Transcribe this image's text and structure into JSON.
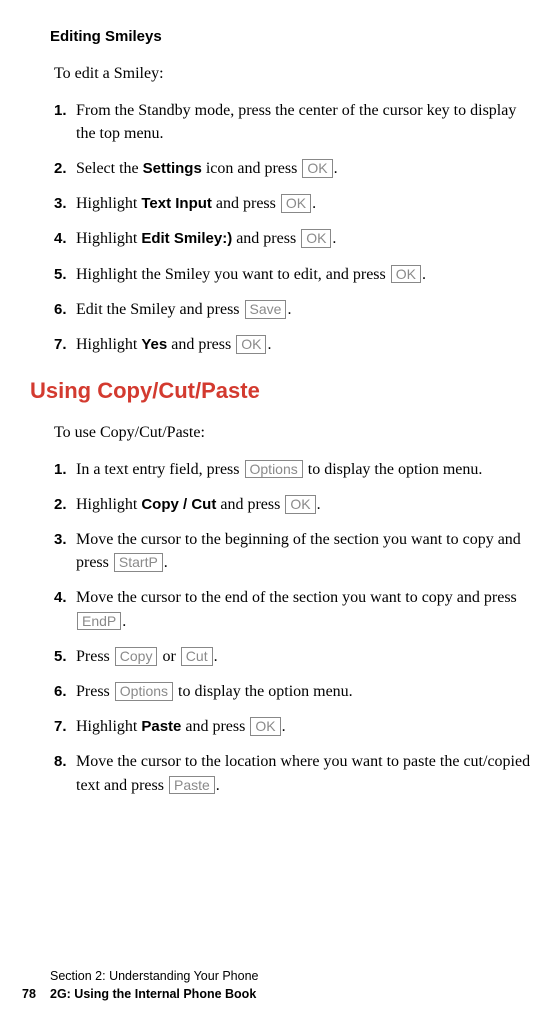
{
  "section1": {
    "heading": "Editing Smileys",
    "intro": "To edit a Smiley:",
    "steps": [
      {
        "num": "1.",
        "pre": "From the Standby mode, press the center of the cursor key to display the top menu."
      },
      {
        "num": "2.",
        "pre": "Select the ",
        "bold": "Settings",
        "mid": " icon and press ",
        "key": "OK",
        "post": "."
      },
      {
        "num": "3.",
        "pre": "Highlight ",
        "bold": "Text Input",
        "mid": " and press ",
        "key": "OK",
        "post": "."
      },
      {
        "num": "4.",
        "pre": "Highlight ",
        "bold": "Edit Smiley:)",
        "mid": " and press ",
        "key": "OK",
        "post": "."
      },
      {
        "num": "5.",
        "pre": "Highlight the Smiley you want to edit, and press ",
        "key": "OK",
        "post": "."
      },
      {
        "num": "6.",
        "pre": "Edit the Smiley and press ",
        "key": "Save",
        "post": "."
      },
      {
        "num": "7.",
        "pre": "Highlight ",
        "bold": "Yes",
        "mid": " and press ",
        "key": "OK",
        "post": "."
      }
    ]
  },
  "section2": {
    "heading": "Using Copy/Cut/Paste",
    "intro": "To use Copy/Cut/Paste:",
    "steps": [
      {
        "num": "1.",
        "pre": "In a text entry field, press ",
        "key": "Options",
        "post": " to display the option menu."
      },
      {
        "num": "2.",
        "pre": "Highlight ",
        "bold": "Copy / Cut",
        "mid": " and press ",
        "key": "OK",
        "post": "."
      },
      {
        "num": "3.",
        "pre": "Move the cursor to the beginning of the section you want to copy and press ",
        "key": "StartP",
        "post": "."
      },
      {
        "num": "4.",
        "pre": "Move the cursor to the end of the section you want to copy and press ",
        "key": "EndP",
        "post": "."
      },
      {
        "num": "5.",
        "pre": "Press ",
        "key": "Copy",
        "mid2": " or ",
        "key2": "Cut",
        "post": "."
      },
      {
        "num": "6.",
        "pre": "Press ",
        "key": "Options",
        "post": " to display the option menu."
      },
      {
        "num": "7.",
        "pre": "Highlight ",
        "bold": "Paste",
        "mid": " and press ",
        "key": "OK",
        "post": "."
      },
      {
        "num": "8.",
        "pre": "Move the cursor to the location where you want to paste the cut/copied text and press ",
        "key": "Paste",
        "post": "."
      }
    ]
  },
  "footer": {
    "line1": "Section 2: Understanding Your Phone",
    "pagenum": "78",
    "line2": "2G: Using the Internal Phone Book"
  }
}
